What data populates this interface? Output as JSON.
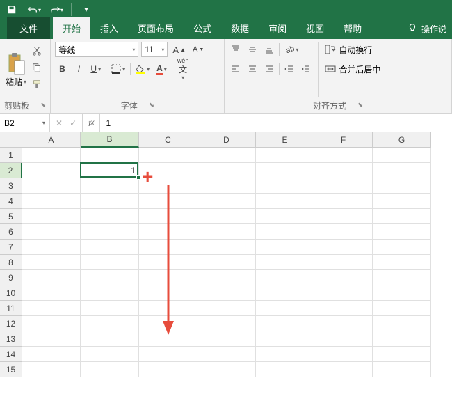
{
  "titlebar": {
    "save_icon": "save-icon",
    "undo_icon": "undo-icon",
    "redo_icon": "redo-icon"
  },
  "tabs": {
    "file": "文件",
    "home": "开始",
    "insert": "插入",
    "layout": "页面布局",
    "formulas": "公式",
    "data": "数据",
    "review": "审阅",
    "view": "视图",
    "help": "帮助",
    "tellme": "操作说"
  },
  "ribbon": {
    "clipboard": {
      "paste": "粘贴",
      "label": "剪贴板"
    },
    "font": {
      "name": "等线",
      "size": "11",
      "bold": "B",
      "italic": "I",
      "underline": "U",
      "label": "字体",
      "wen": "wén"
    },
    "align": {
      "label": "对齐方式",
      "wrap": "自动换行",
      "merge": "合并后居中"
    }
  },
  "namebox": "B2",
  "formula": "1",
  "columns": [
    "A",
    "B",
    "C",
    "D",
    "E",
    "F",
    "G"
  ],
  "rows": [
    "1",
    "2",
    "3",
    "4",
    "5",
    "6",
    "7",
    "8",
    "9",
    "10",
    "11",
    "12",
    "13",
    "14",
    "15"
  ],
  "active": {
    "col": 1,
    "row": 1,
    "value": "1"
  },
  "colors": {
    "accent": "#217346",
    "annotation": "#e74c3c"
  }
}
